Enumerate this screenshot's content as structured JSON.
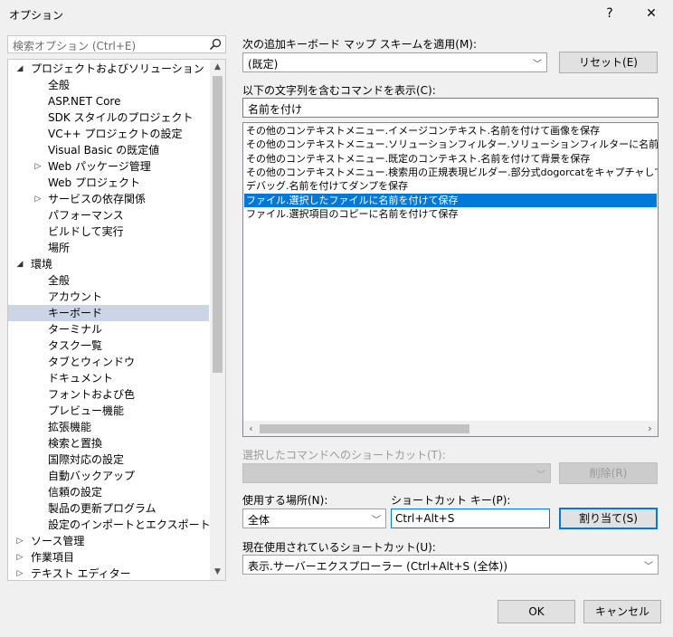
{
  "window": {
    "title": "オプション",
    "help_label": "?",
    "close_label": "✕"
  },
  "search": {
    "placeholder": "検索オプション (Ctrl+E)"
  },
  "tree": {
    "items": [
      {
        "label": "プロジェクトおよびソリューション",
        "level": 0,
        "expander": "◢",
        "selected": false
      },
      {
        "label": "全般",
        "level": 1,
        "expander": "",
        "selected": false
      },
      {
        "label": "ASP.NET Core",
        "level": 1,
        "expander": "",
        "selected": false
      },
      {
        "label": "SDK スタイルのプロジェクト",
        "level": 1,
        "expander": "",
        "selected": false
      },
      {
        "label": "VC++ プロジェクトの設定",
        "level": 1,
        "expander": "",
        "selected": false
      },
      {
        "label": "Visual Basic の既定値",
        "level": 1,
        "expander": "",
        "selected": false
      },
      {
        "label": "Web パッケージ管理",
        "level": 1,
        "expander": "▷",
        "selected": false
      },
      {
        "label": "Web プロジェクト",
        "level": 1,
        "expander": "",
        "selected": false
      },
      {
        "label": "サービスの依存関係",
        "level": 1,
        "expander": "▷",
        "selected": false
      },
      {
        "label": "パフォーマンス",
        "level": 1,
        "expander": "",
        "selected": false
      },
      {
        "label": "ビルドして実行",
        "level": 1,
        "expander": "",
        "selected": false
      },
      {
        "label": "場所",
        "level": 1,
        "expander": "",
        "selected": false
      },
      {
        "label": "環境",
        "level": 0,
        "expander": "◢",
        "selected": false
      },
      {
        "label": "全般",
        "level": 1,
        "expander": "",
        "selected": false
      },
      {
        "label": "アカウント",
        "level": 1,
        "expander": "",
        "selected": false
      },
      {
        "label": "キーボード",
        "level": 1,
        "expander": "",
        "selected": true
      },
      {
        "label": "ターミナル",
        "level": 1,
        "expander": "",
        "selected": false
      },
      {
        "label": "タスク一覧",
        "level": 1,
        "expander": "",
        "selected": false
      },
      {
        "label": "タブとウィンドウ",
        "level": 1,
        "expander": "",
        "selected": false
      },
      {
        "label": "ドキュメント",
        "level": 1,
        "expander": "",
        "selected": false
      },
      {
        "label": "フォントおよび色",
        "level": 1,
        "expander": "",
        "selected": false
      },
      {
        "label": "プレビュー機能",
        "level": 1,
        "expander": "",
        "selected": false
      },
      {
        "label": "拡張機能",
        "level": 1,
        "expander": "",
        "selected": false
      },
      {
        "label": "検索と置換",
        "level": 1,
        "expander": "",
        "selected": false
      },
      {
        "label": "国際対応の設定",
        "level": 1,
        "expander": "",
        "selected": false
      },
      {
        "label": "自動バックアップ",
        "level": 1,
        "expander": "",
        "selected": false
      },
      {
        "label": "信頼の設定",
        "level": 1,
        "expander": "",
        "selected": false
      },
      {
        "label": "製品の更新プログラム",
        "level": 1,
        "expander": "",
        "selected": false
      },
      {
        "label": "設定のインポートとエクスポート",
        "level": 1,
        "expander": "",
        "selected": false
      },
      {
        "label": "ソース管理",
        "level": 0,
        "expander": "▷",
        "selected": false
      },
      {
        "label": "作業項目",
        "level": 0,
        "expander": "▷",
        "selected": false
      },
      {
        "label": "テキスト エディター",
        "level": 0,
        "expander": "▷",
        "selected": false
      }
    ]
  },
  "mapping_scheme": {
    "label": "次の追加キーボード マップ スキームを適用(M):",
    "value": "(既定)"
  },
  "reset_button": {
    "label": "リセット(E)"
  },
  "command_filter": {
    "label": "以下の文字列を含むコマンドを表示(C):",
    "value": "名前を付け"
  },
  "commands": {
    "items": [
      {
        "text": "その他のコンテキストメニュー.イメージコンテキスト.名前を付けて画像を保存",
        "selected": false
      },
      {
        "text": "その他のコンテキストメニュー.ソリューションフィルター.ソリューションフィルターに名前を付けて保存",
        "selected": false
      },
      {
        "text": "その他のコンテキストメニュー.既定のコンテキスト.名前を付けて背景を保存",
        "selected": false
      },
      {
        "text": "その他のコンテキストメニュー.検索用の正規表現ビルダー.部分式dogorcatをキャプチャしてpetという",
        "selected": false
      },
      {
        "text": "デバッグ.名前を付けてダンプを保存",
        "selected": false
      },
      {
        "text": "ファイル.選択したファイルに名前を付けて保存",
        "selected": true
      },
      {
        "text": "ファイル.選択項目のコピーに名前を付けて保存",
        "selected": false
      }
    ]
  },
  "selected_shortcuts": {
    "label": "選択したコマンドへのショートカット(T):",
    "value": ""
  },
  "remove_button": {
    "label": "削除(R)"
  },
  "use_in": {
    "label": "使用する場所(N):",
    "value": "全体"
  },
  "shortcut_key": {
    "label": "ショートカット キー(P):",
    "value": "Ctrl+Alt+S"
  },
  "assign_button": {
    "label": "割り当て(S)"
  },
  "current_shortcut": {
    "label": "現在使用されているショートカット(U):",
    "value": "表示.サーバーエクスプローラー (Ctrl+Alt+S (全体))"
  },
  "ok_button": {
    "label": "OK"
  },
  "cancel_button": {
    "label": "キャンセル"
  },
  "colors": {
    "accent": "#0078d7",
    "tree_selected": "#ccd5e6"
  }
}
